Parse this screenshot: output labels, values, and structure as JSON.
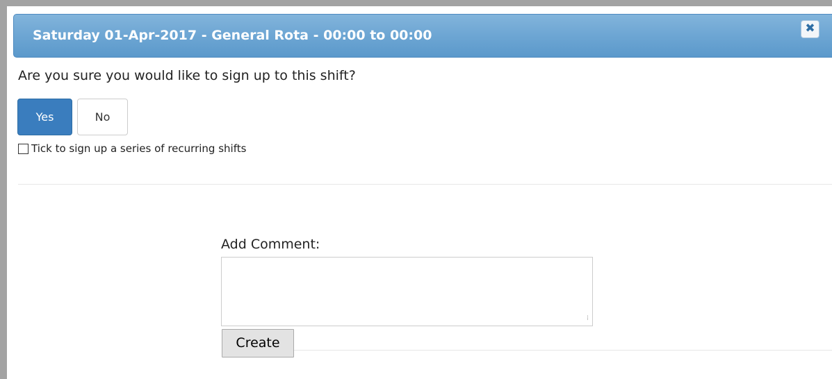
{
  "dialog": {
    "title": "Saturday 01-Apr-2017 - General Rota - 00:00 to 00:00",
    "close_glyph": "✖",
    "close_icon": "close-icon"
  },
  "signup": {
    "question": "Are you sure you would like to sign up to this shift?",
    "yes_label": "Yes",
    "no_label": "No",
    "recurring_label": "Tick to sign up a series of recurring shifts",
    "recurring_checked": false
  },
  "comment": {
    "label": "Add Comment:",
    "value": "",
    "create_label": "Create"
  },
  "colors": {
    "title_bar": "#6fa7d4",
    "primary_button": "#3a7dbe"
  }
}
